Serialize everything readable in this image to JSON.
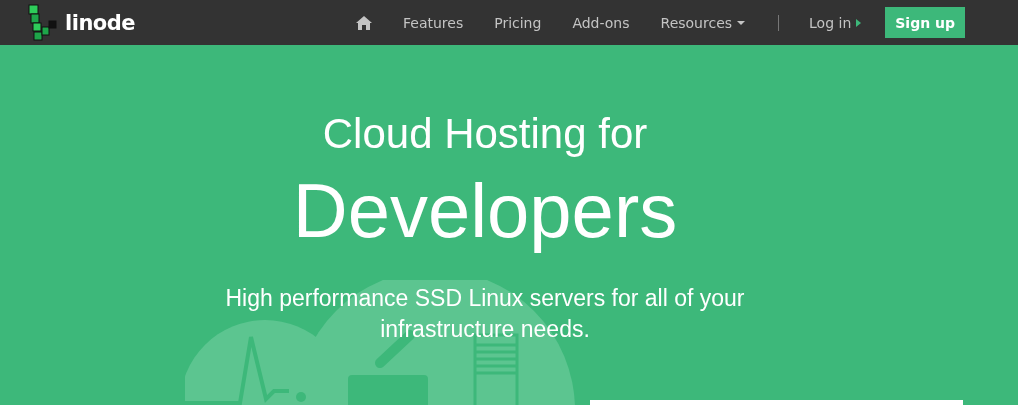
{
  "logo": {
    "text": "linode"
  },
  "nav": {
    "links": [
      {
        "label": "Features",
        "kind": "link"
      },
      {
        "label": "Pricing",
        "kind": "link"
      },
      {
        "label": "Add-ons",
        "kind": "link"
      },
      {
        "label": "Resources",
        "kind": "dropdown"
      }
    ],
    "login": "Log in",
    "signup": "Sign up"
  },
  "hero": {
    "title": "Cloud Hosting for",
    "headline": "Developers",
    "subtitle": "High performance SSD Linux servers for all of your infrastructure needs."
  }
}
